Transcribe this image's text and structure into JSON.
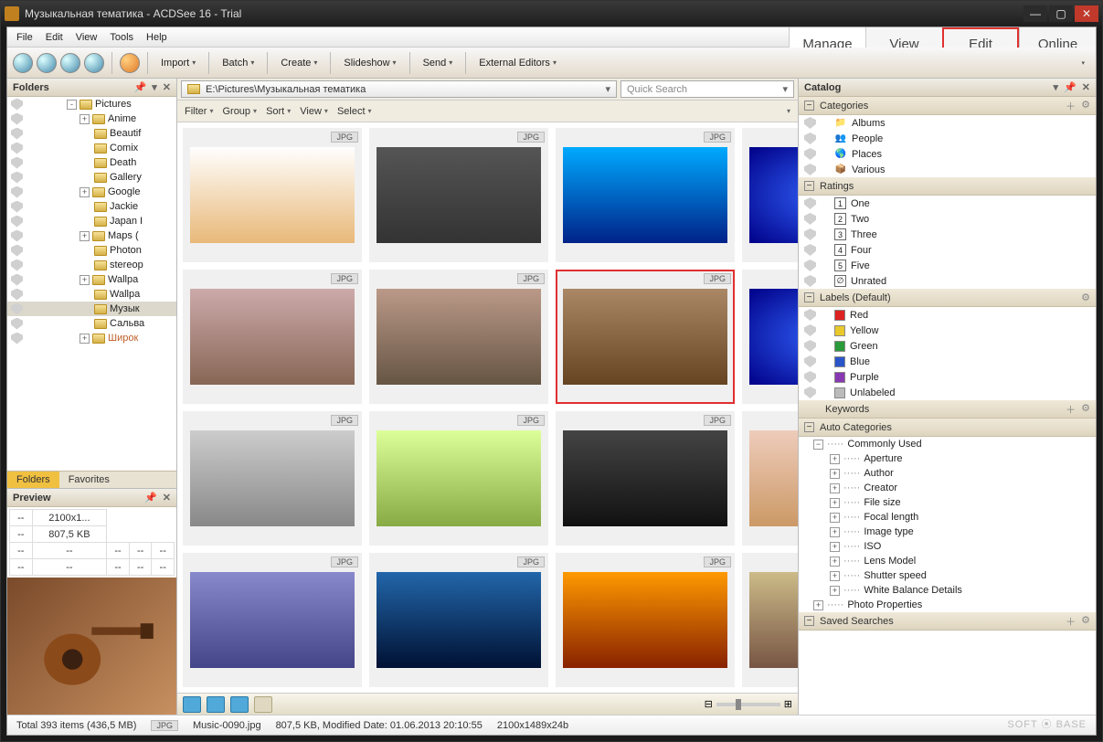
{
  "title": "Музыкальная тематика - ACDSee 16 - Trial",
  "menubar": [
    "File",
    "Edit",
    "View",
    "Tools",
    "Help"
  ],
  "modes": {
    "manage": "Manage",
    "view": "View",
    "edit": "Edit",
    "online": "Online"
  },
  "toolbar_menus": [
    "Import",
    "Batch",
    "Create",
    "Slideshow",
    "Send",
    "External Editors"
  ],
  "folders": {
    "title": "Folders",
    "items": [
      {
        "label": "Pictures",
        "exp": "-",
        "indent": 0
      },
      {
        "label": "Anime",
        "exp": "+",
        "indent": 1
      },
      {
        "label": "Beautif",
        "exp": "",
        "indent": 1
      },
      {
        "label": "Comix",
        "exp": "",
        "indent": 1
      },
      {
        "label": "Death",
        "exp": "",
        "indent": 1
      },
      {
        "label": "Gallery",
        "exp": "",
        "indent": 1
      },
      {
        "label": "Google",
        "exp": "+",
        "indent": 1
      },
      {
        "label": "Jackie",
        "exp": "",
        "indent": 1
      },
      {
        "label": "Japan I",
        "exp": "",
        "indent": 1
      },
      {
        "label": "Maps (",
        "exp": "+",
        "indent": 1
      },
      {
        "label": "Photon",
        "exp": "",
        "indent": 1
      },
      {
        "label": "stereop",
        "exp": "",
        "indent": 1
      },
      {
        "label": "Wallpa",
        "exp": "+",
        "indent": 1
      },
      {
        "label": "Wallpa",
        "exp": "",
        "indent": 1
      },
      {
        "label": "Музык",
        "exp": "",
        "indent": 1,
        "sel": true
      },
      {
        "label": "Сальва",
        "exp": "",
        "indent": 1
      },
      {
        "label": "Широк",
        "exp": "+",
        "indent": 1,
        "cur": true
      }
    ],
    "tabs": {
      "folders": "Folders",
      "favorites": "Favorites"
    }
  },
  "preview": {
    "title": "Preview",
    "dim": "2100x1...",
    "size": "807,5 KB",
    "dash": "--"
  },
  "path": "E:\\Pictures\\Музыкальная тематика",
  "search_placeholder": "Quick Search",
  "filterbar": [
    "Filter",
    "Group",
    "Sort",
    "View",
    "Select"
  ],
  "thumb_badge": "JPG",
  "thumbs_selected_index": 6,
  "catalog": {
    "title": "Catalog",
    "categories": {
      "hdr": "Categories",
      "items": [
        "Albums",
        "People",
        "Places",
        "Various"
      ]
    },
    "ratings": {
      "hdr": "Ratings",
      "items": [
        "One",
        "Two",
        "Three",
        "Four",
        "Five",
        "Unrated"
      ]
    },
    "labels": {
      "hdr": "Labels (Default)",
      "items": [
        {
          "name": "Red",
          "c": "#d22"
        },
        {
          "name": "Yellow",
          "c": "#e8c82a"
        },
        {
          "name": "Green",
          "c": "#2a9a3a"
        },
        {
          "name": "Blue",
          "c": "#2a55c8"
        },
        {
          "name": "Purple",
          "c": "#8838b0"
        },
        {
          "name": "Unlabeled",
          "c": "#bbb"
        }
      ]
    },
    "keywords": "Keywords",
    "auto": {
      "hdr": "Auto Categories",
      "root": "Commonly Used",
      "items": [
        "Aperture",
        "Author",
        "Creator",
        "File size",
        "Focal length",
        "Image type",
        "ISO",
        "Lens Model",
        "Shutter speed",
        "White Balance Details"
      ],
      "photo": "Photo Properties"
    },
    "saved": "Saved Searches"
  },
  "status": {
    "total": "Total 393 items   (436,5 MB)",
    "badge": "JPG",
    "file": "Music-0090.jpg",
    "info": "807,5 KB, Modified Date: 01.06.2013 20:10:55",
    "dim": "2100x1489x24b"
  },
  "watermark": "SOFT ⦿ BASE"
}
